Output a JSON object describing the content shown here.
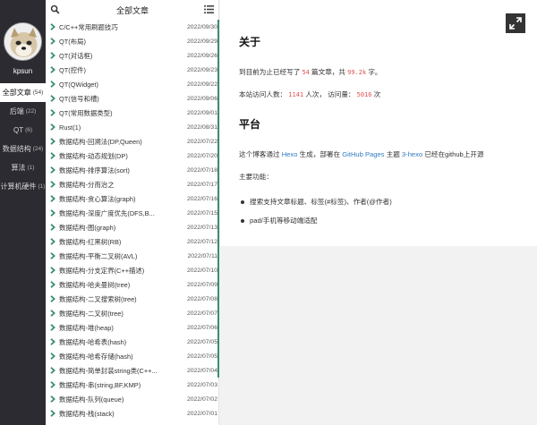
{
  "sidebar": {
    "author": "kpsun",
    "categories": [
      {
        "name": "全部文章",
        "count": "(54)",
        "active": true
      },
      {
        "name": "后端",
        "count": "(22)"
      },
      {
        "name": "QT",
        "count": "(6)"
      },
      {
        "name": "数据结构",
        "count": "(24)"
      },
      {
        "name": "算法",
        "count": "(1)"
      },
      {
        "name": "计算机硬件",
        "count": "(1)"
      }
    ]
  },
  "list": {
    "title": "全部文章",
    "items": [
      {
        "name": "C/C++常用刷题技巧",
        "date": "2022/09/30"
      },
      {
        "name": "QT(布局)",
        "date": "2022/09/29"
      },
      {
        "name": "QT(对话框)",
        "date": "2022/09/26"
      },
      {
        "name": "QT(控件)",
        "date": "2022/09/23"
      },
      {
        "name": "QT(QWidget)",
        "date": "2022/09/22"
      },
      {
        "name": "QT(信号和槽)",
        "date": "2022/09/06"
      },
      {
        "name": "QT(常用数据类型)",
        "date": "2022/09/01"
      },
      {
        "name": "Rust(1)",
        "date": "2022/08/31"
      },
      {
        "name": "数据结构-回溯法(DP,Queen)",
        "date": "2022/07/22"
      },
      {
        "name": "数据结构-动态规划(DP)",
        "date": "2022/07/20"
      },
      {
        "name": "数据结构-排序算法(sort)",
        "date": "2022/07/18"
      },
      {
        "name": "数据结构-分而治之",
        "date": "2022/07/17"
      },
      {
        "name": "数据结构-贪心算法(graph)",
        "date": "2022/07/16"
      },
      {
        "name": "数据结构-深度广度优先(DFS,B...",
        "date": "2022/07/15"
      },
      {
        "name": "数据结构-图(graph)",
        "date": "2022/07/13"
      },
      {
        "name": "数据结构-红黑树(RB)",
        "date": "2022/07/12"
      },
      {
        "name": "数据结构-平衡二叉树(AVL)",
        "date": "2022/07/11"
      },
      {
        "name": "数据结构-分支定界(C++描述)",
        "date": "2022/07/10"
      },
      {
        "name": "数据结构-哈夫曼树(tree)",
        "date": "2022/07/09"
      },
      {
        "name": "数据结构-二叉搜索树(tree)",
        "date": "2022/07/08"
      },
      {
        "name": "数据结构-二叉树(tree)",
        "date": "2022/07/07"
      },
      {
        "name": "数据结构-堆(heap)",
        "date": "2022/07/06"
      },
      {
        "name": "数据结构-哈希表(hash)",
        "date": "2022/07/05"
      },
      {
        "name": "数据结构-哈希存储(hash)",
        "date": "2022/07/05"
      },
      {
        "name": "数据结构-简单封装string类(C++...",
        "date": "2022/07/04"
      },
      {
        "name": "数据结构-串(string,BF,KMP)",
        "date": "2022/07/03"
      },
      {
        "name": "数据结构-队列(queue)",
        "date": "2022/07/02"
      },
      {
        "name": "数据结构-栈(stack)",
        "date": "2022/07/01"
      }
    ]
  },
  "about": {
    "title": "关于",
    "line1_pre": "到目前为止已经写了",
    "post_count": "54",
    "line1_mid": "篇文章，共",
    "word_count": "99.2k",
    "line1_post": "字。",
    "line2_pre": "本站访问人数：",
    "visitors": "1141",
    "line2_mid": "人次，  访问量：",
    "views": "5016",
    "line2_post": "次"
  },
  "platform": {
    "title": "平台",
    "p1_pre": "这个博客通过",
    "hexo": "Hexo",
    "p1_mid1": "生成，部署在",
    "github_pages": "GitHub Pages",
    "p1_mid2": "主题",
    "theme": "3-hexo",
    "p1_post": "已经在github上开源",
    "features_title": "主要功能：",
    "features": [
      "搜索支持文章标题、标签(#标签)、作者(@作者)",
      "pad/手机等移动端适配"
    ]
  },
  "colors": {
    "sidebar_bg": "#2b2b31",
    "accent_bar": "#3a8f6a",
    "link": "#2f7bbf",
    "number": "#e05050"
  }
}
